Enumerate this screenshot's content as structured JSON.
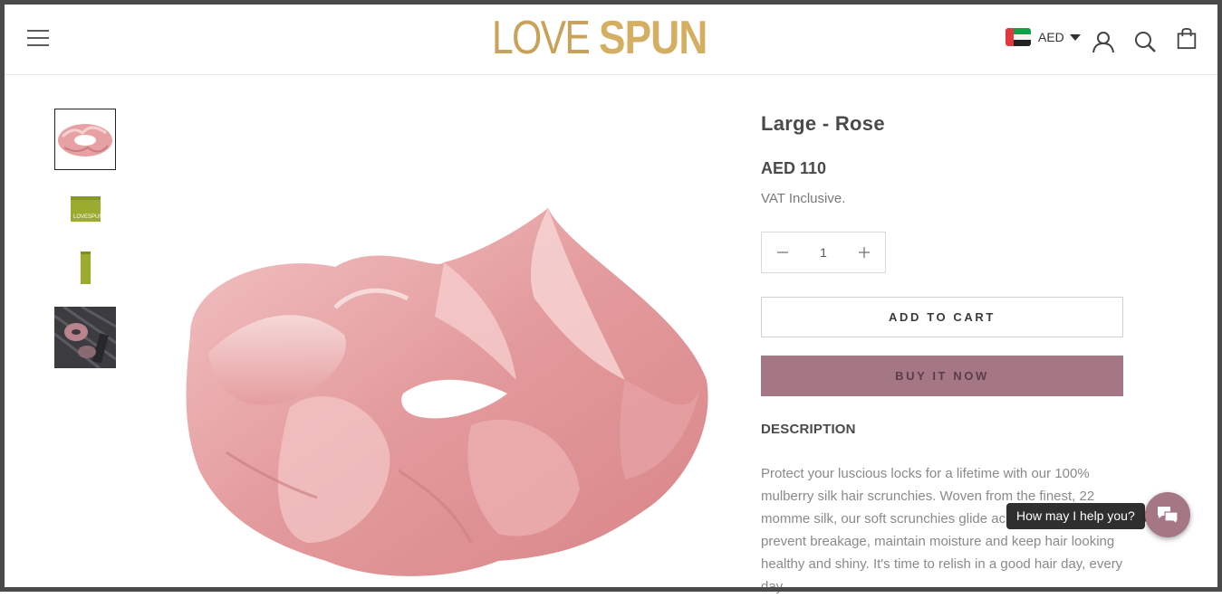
{
  "header": {
    "logo_part1": "LOVE",
    "logo_part2": "SPUN",
    "currency": {
      "code": "AED",
      "flag": "uae-flag"
    },
    "icons": [
      "menu-icon",
      "account-icon",
      "search-icon",
      "cart-icon"
    ]
  },
  "thumbnails": [
    {
      "name": "thumbnail-scrunchie-rose",
      "active": true
    },
    {
      "name": "thumbnail-green-box",
      "active": false
    },
    {
      "name": "thumbnail-green-sleeve",
      "active": false
    },
    {
      "name": "thumbnail-lifestyle",
      "active": false
    }
  ],
  "product": {
    "title": "Large - Rose",
    "price": "AED 110",
    "vat_note": "VAT Inclusive.",
    "quantity": "1",
    "add_to_cart_label": "ADD TO CART",
    "buy_now_label": "BUY IT NOW",
    "description_heading": "DESCRIPTION",
    "description_text": "Protect your luscious locks for a lifetime with our 100% mulberry silk hair scrunchies. Woven from the finest, 22 momme silk, our soft scrunchies glide across your hair to prevent breakage, maintain moisture and keep hair looking healthy and shiny. It's time to relish in a good hair day, every day."
  },
  "chat": {
    "tooltip": "How may I help you?"
  },
  "colors": {
    "accent": "#a57785",
    "logo_gold": "#c9a25a",
    "thumb_green": "#9aab2e"
  }
}
